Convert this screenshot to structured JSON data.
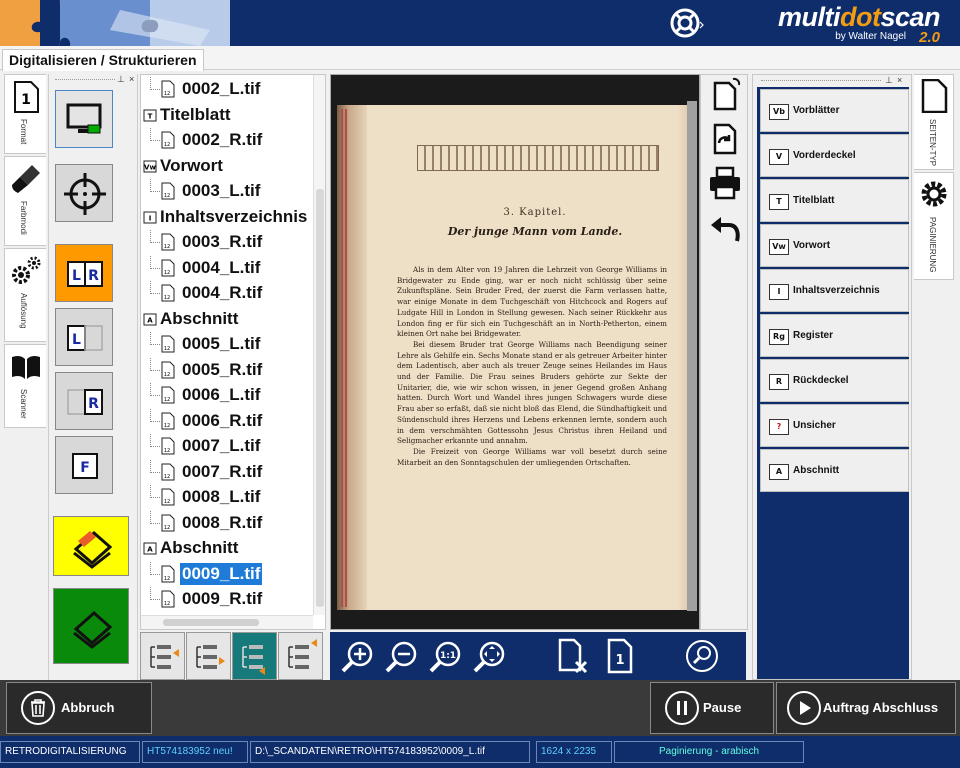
{
  "header": {
    "logo_prefix": "multi",
    "logo_dot": "dot",
    "logo_suffix": "scan",
    "logo_subtitle": "by Walter Nagel",
    "logo_version": "2.0",
    "accent": "#f39c12",
    "bg": "#0f2d6b"
  },
  "tabs": [
    {
      "label": "Digitalisieren / Strukturieren"
    }
  ],
  "left_tabs": [
    {
      "label": "Format",
      "icon": "page-number-icon"
    },
    {
      "label": "Farbmodi",
      "icon": "brush-icon"
    },
    {
      "label": "Auflösung",
      "icon": "gears-icon"
    },
    {
      "label": "Scanner",
      "icon": "book-icon"
    }
  ],
  "scan_buttons": [
    {
      "name": "monitor-button",
      "icon": "monitor-icon",
      "color": "#d8d8d8"
    },
    {
      "name": "crosshair-button",
      "icon": "crosshair-icon",
      "color": "#d8d8d8"
    },
    {
      "name": "scan-left-right-button",
      "label": "LR",
      "color": "#ff9900"
    },
    {
      "name": "scan-left-button",
      "label": "L",
      "color": "#d8d8d8"
    },
    {
      "name": "scan-right-button",
      "label": "R",
      "color": "#d8d8d8"
    },
    {
      "name": "scan-full-button",
      "label": "F",
      "color": "#d8d8d8"
    },
    {
      "name": "scan-start-button",
      "icon": "scanner-icon",
      "color": "#ffff00"
    },
    {
      "name": "scan-green-button",
      "icon": "scanner-icon",
      "color": "#0a8a0a"
    }
  ],
  "files": [
    {
      "type": "file",
      "label": "0002_L.tif",
      "icon": "12"
    },
    {
      "type": "section",
      "label": "Titelblatt",
      "icon": "T"
    },
    {
      "type": "file",
      "label": "0002_R.tif",
      "icon": "12"
    },
    {
      "type": "section",
      "label": "Vorwort",
      "icon": "Vw"
    },
    {
      "type": "file",
      "label": "0003_L.tif",
      "icon": "12"
    },
    {
      "type": "section",
      "label": "Inhaltsverzeichnis",
      "icon": "I"
    },
    {
      "type": "file",
      "label": "0003_R.tif",
      "icon": "12"
    },
    {
      "type": "file",
      "label": "0004_L.tif",
      "icon": "12"
    },
    {
      "type": "file",
      "label": "0004_R.tif",
      "icon": "12"
    },
    {
      "type": "section",
      "label": "Abschnitt",
      "icon": "A"
    },
    {
      "type": "file",
      "label": "0005_L.tif",
      "icon": "12"
    },
    {
      "type": "file",
      "label": "0005_R.tif",
      "icon": "12"
    },
    {
      "type": "file",
      "label": "0006_L.tif",
      "icon": "12"
    },
    {
      "type": "file",
      "label": "0006_R.tif",
      "icon": "12"
    },
    {
      "type": "file",
      "label": "0007_L.tif",
      "icon": "12"
    },
    {
      "type": "file",
      "label": "0007_R.tif",
      "icon": "12"
    },
    {
      "type": "file",
      "label": "0008_L.tif",
      "icon": "12"
    },
    {
      "type": "file",
      "label": "0008_R.tif",
      "icon": "12"
    },
    {
      "type": "section",
      "label": "Abschnitt",
      "icon": "A"
    },
    {
      "type": "file",
      "label": "0009_L.tif",
      "icon": "12",
      "selected": true
    },
    {
      "type": "file",
      "label": "0009_R.tif",
      "icon": "12"
    }
  ],
  "page": {
    "chapter": "3. Kapitel.",
    "title": "Der junge Mann vom Lande.",
    "paragraphs": [
      "Als in dem Alter von 19 Jahren die Lehrzeit von George Williams in Bridgewater zu Ende ging, war er noch nicht schlüssig über seine Zukunftspläne. Sein Bruder Fred, der zuerst die Farm verlassen hatte, war einige Monate in dem Tuchgeschäft von Hitchcock and Rogers auf Ludgate Hill in London in Stellung gewesen. Nach seiner Rückkehr aus London fing er für sich ein Tuchgeschäft an in North-Petherton, einem kleinen Ort nahe bei Bridgewater.",
      "Bei diesem Bruder trat George Williams nach Beendigung seiner Lehre als Gehilfe ein. Sechs Monate stand er als getreuer Arbeiter hinter dem Ladentisch, aber auch als treuer Zeuge seines Heilandes im Haus und der Familie. Die Frau seines Bruders gehörte zur Sekte der Unitarier, die, wie wir schon wissen, in jener Gegend großen Anhang hatten. Durch Wort und Wandel ihres jungen Schwagers wurde diese Frau aber so erfaßt, daß sie nicht bloß das Elend, die Sündhaftigkeit und Sündenschuld ihres Herzens und Lebens erkennen lernte, sondern auch in dem verschmähten Gottessohn Jesus Christus ihren Heiland und Seligmacher erkannte und annahm.",
      "Die Freizeit von George Williams war voll besetzt durch seine Mitarbeit an den Sonntagschulen der umliegenden Ortschaften."
    ]
  },
  "viewer_tools": [
    {
      "name": "rotate-page-button",
      "icon": "rotate-page-icon"
    },
    {
      "name": "rotate-right-button",
      "icon": "rotate-right-icon"
    },
    {
      "name": "print-button",
      "icon": "printer-icon"
    },
    {
      "name": "undo-button",
      "icon": "undo-icon"
    }
  ],
  "zoom_tools": [
    {
      "name": "zoom-in-button",
      "icon": "zoom-in-icon"
    },
    {
      "name": "zoom-out-button",
      "icon": "zoom-out-icon"
    },
    {
      "name": "zoom-actual-button",
      "icon": "zoom-1to1-icon",
      "label": "1:1"
    },
    {
      "name": "zoom-fit-button",
      "icon": "zoom-fit-icon"
    },
    {
      "name": "delete-page-button",
      "icon": "delete-page-icon"
    },
    {
      "name": "page-number-button",
      "icon": "page-number-icon",
      "label": "1"
    },
    {
      "name": "search-button",
      "icon": "search-icon"
    }
  ],
  "sections": [
    {
      "code": "Vb",
      "label": "Vorblätter"
    },
    {
      "code": "V",
      "label": "Vorderdeckel"
    },
    {
      "code": "T",
      "label": "Titelblatt"
    },
    {
      "code": "Vw",
      "label": "Vorwort"
    },
    {
      "code": "I",
      "label": "Inhaltsverzeichnis"
    },
    {
      "code": "Rg",
      "label": "Register"
    },
    {
      "code": "R",
      "label": "Rückdeckel"
    },
    {
      "code": "?",
      "label": "Unsicher",
      "code_color": "#c02020"
    },
    {
      "code": "A",
      "label": "Abschnitt"
    }
  ],
  "right_tabs": [
    {
      "label": "SEITEN-TYP",
      "icon": "page-icon"
    },
    {
      "label": "PAGINIERUNG",
      "icon": "gear-icon"
    }
  ],
  "actions": {
    "abort": "Abbruch",
    "pause": "Pause",
    "finish": "Auftrag Abschluss"
  },
  "status": {
    "mode": "RETRODIGITALISIERUNG",
    "job": "HT574183952 neu!",
    "path": "D:\\_SCANDATEN\\RETRO\\HT574183952\\0009_L.tif",
    "resolution": "1624 x 2235",
    "pagination": "Paginierung - arabisch"
  }
}
